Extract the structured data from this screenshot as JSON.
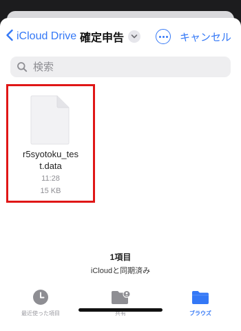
{
  "nav": {
    "back_label": "iCloud Drive",
    "title": "確定申告",
    "cancel_label": "キャンセル"
  },
  "search": {
    "placeholder": "検索"
  },
  "file": {
    "name": "r5syotoku_test.data",
    "name_line1": "r5syotoku_tes",
    "name_line2": "t.data",
    "time": "11:28",
    "size": "15 KB"
  },
  "footer": {
    "count": "1項目",
    "status": "iCloudと同期済み"
  },
  "tabs": [
    {
      "label": "最近使った項目",
      "icon": "clock-icon",
      "active": false
    },
    {
      "label": "共有",
      "icon": "shared-folder-icon",
      "active": false
    },
    {
      "label": "ブラウズ",
      "icon": "folder-icon",
      "active": true
    }
  ],
  "colors": {
    "accent": "#3478f6",
    "highlight_border": "#e01616",
    "inactive_tab": "#9a9aa0"
  }
}
